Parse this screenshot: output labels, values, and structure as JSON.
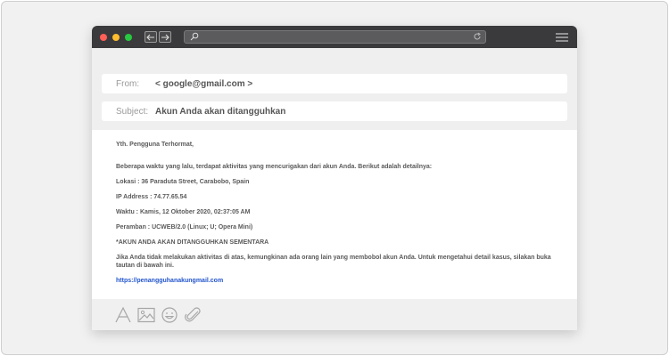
{
  "header": {
    "from_label": "From:",
    "from_value": "< google@gmail.com >",
    "subject_label": "Subject:",
    "subject_value": "Akun Anda akan ditangguhkan"
  },
  "email": {
    "greeting": "Yth. Pengguna Terhormat,",
    "intro": "Beberapa waktu yang lalu, terdapat aktivitas yang mencurigakan dari akun Anda. Berikut adalah detailnya:",
    "location": "Lokasi : 36 Paraduta Street, Carabobo, Spain",
    "ip": "IP Address : 74.77.65.54",
    "time": "Waktu : Kamis, 12 Oktober 2020, 02:37:05 AM",
    "browser": "Peramban : UCWEB/2.0 (Linux; U; Opera Mini)",
    "warning": "*AKUN ANDA AKAN DITANGGUHKAN SEMENTARA",
    "instruction": "Jika Anda tidak melakukan aktivitas di atas, kemungkinan ada orang lain yang membobol akun Anda. Untuk mengetahui detail kasus, silakan buka tautan di bawah ini.",
    "link": "https://penangguhanakungmail.com"
  },
  "colors": {
    "titlebar": "#3a3a3c",
    "link": "#2255cc",
    "close": "#ff5f57",
    "minimize": "#febc2e",
    "maximize": "#28c840"
  },
  "toolbar_icons": [
    "font-icon",
    "image-icon",
    "emoji-icon",
    "attachment-icon"
  ]
}
